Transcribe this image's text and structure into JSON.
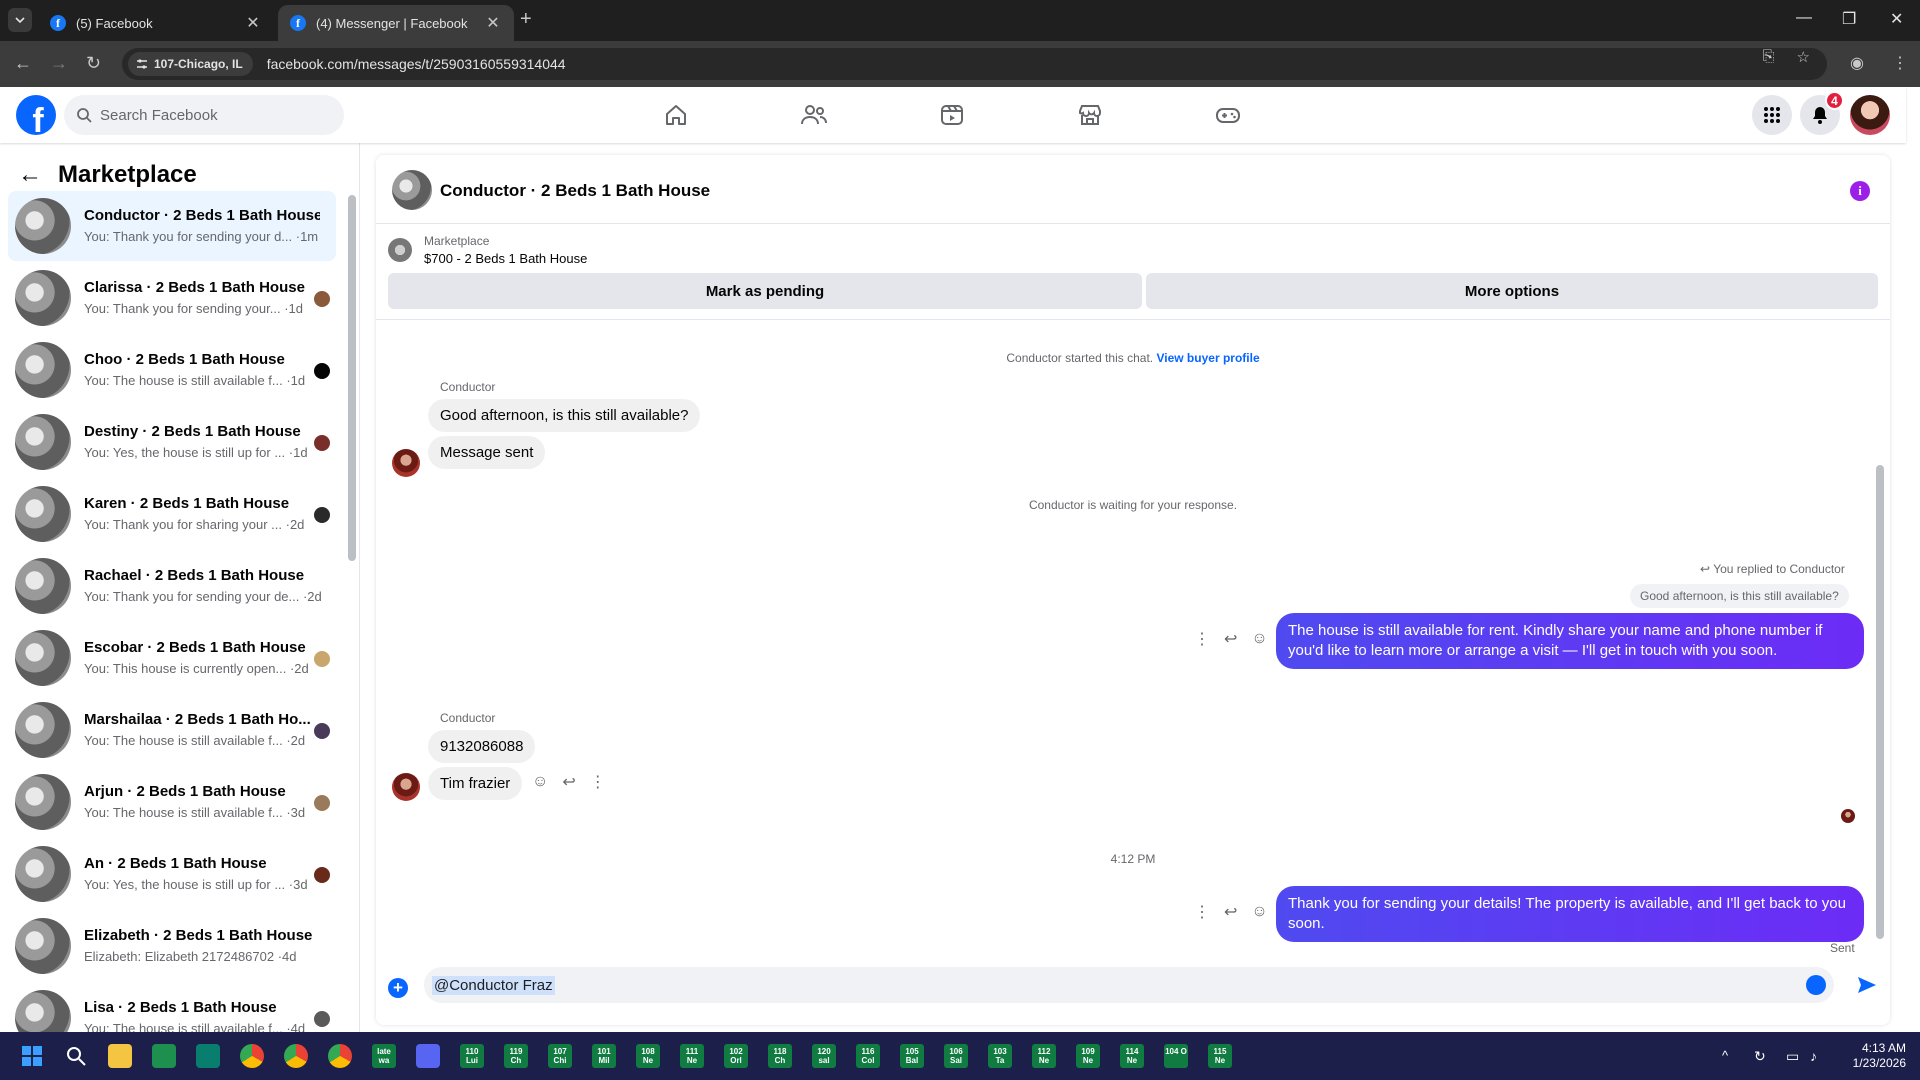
{
  "browser": {
    "tabs": [
      {
        "title": "(5) Facebook",
        "active": false
      },
      {
        "title": "(4) Messenger | Facebook",
        "active": true
      }
    ],
    "location_chip": "107-Chicago, IL",
    "url": "facebook.com/messages/t/25903160559314044"
  },
  "fb_header": {
    "search_placeholder": "Search Facebook",
    "notification_count": "4"
  },
  "left_panel": {
    "title": "Marketplace",
    "conversations": [
      {
        "name": "Conductor · 2 Beds 1 Bath House",
        "preview": "You: Thank you for sending your d... ·1m",
        "selected": true
      },
      {
        "name": "Clarissa · 2 Beds 1 Bath House",
        "preview": "You: Thank you for sending your... ·1d"
      },
      {
        "name": "Choo · 2 Beds 1 Bath House",
        "preview": "You: The house is still available f... ·1d"
      },
      {
        "name": "Destiny · 2 Beds 1 Bath House",
        "preview": "You: Yes, the house is still up for ... ·1d"
      },
      {
        "name": "Karen · 2 Beds 1 Bath House",
        "preview": "You: Thank you for sharing your ... ·2d"
      },
      {
        "name": "Rachael · 2 Beds 1 Bath House",
        "preview": "You: Thank you for sending your de... ·2d"
      },
      {
        "name": "Escobar · 2 Beds 1 Bath House",
        "preview": "You: This house is currently open... ·2d"
      },
      {
        "name": "Marshailaa · 2 Beds 1 Bath Ho...",
        "preview": "You: The house is still available f... ·2d"
      },
      {
        "name": "Arjun · 2 Beds 1 Bath House",
        "preview": "You: The house is still available f... ·3d"
      },
      {
        "name": "An · 2 Beds 1 Bath House",
        "preview": "You: Yes, the house is still up for ... ·3d"
      },
      {
        "name": "Elizabeth · 2 Beds 1 Bath House",
        "preview": "Elizabeth: Elizabeth 2172486702 ·4d"
      },
      {
        "name": "Lisa · 2 Beds 1 Bath House",
        "preview": "You: The house is still available f... ·4d"
      }
    ]
  },
  "chat": {
    "title": "Conductor · 2 Beds 1 Bath House",
    "marketplace_label": "Marketplace",
    "listing": "$700 - 2 Beds 1 Bath House",
    "btn_pending": "Mark as pending",
    "btn_more": "More options",
    "started_text": "Conductor started this chat.",
    "view_profile": "View buyer profile",
    "sender_name": "Conductor",
    "msg1": "Good afternoon, is this still available?",
    "msg2": "Message sent",
    "waiting": "Conductor is waiting for your response.",
    "replied_to": "You replied to Conductor",
    "quoted": "Good afternoon, is this still available?",
    "out1": "The house is still available for rent. Kindly share your name and phone number if you'd like to learn more or arrange a visit — I'll get in touch with you soon.",
    "sender_name2": "Conductor",
    "msg3": "9132086088",
    "msg4": "Tim frazier",
    "timestamp": "4:12 PM",
    "out2": "Thank you for sending your details! The property is available, and I'll get back to you soon.",
    "sent_status": "Sent",
    "composer_text": "@Conductor Fraz"
  },
  "taskbar": {
    "sheets": [
      "late wa",
      "110 Lui",
      "119 Ch",
      "107 Chi",
      "101 Mil",
      "108 Ne",
      "111 Ne",
      "102 Orl",
      "118 Ch",
      "120 sal",
      "116 Col",
      "105 Bal",
      "106 Sal",
      "103 Ta",
      "112 Ne",
      "109 Ne",
      "114 Ne",
      "104 O",
      "115 Ne"
    ],
    "time": "4:13 AM",
    "date": "1/23/2026"
  }
}
